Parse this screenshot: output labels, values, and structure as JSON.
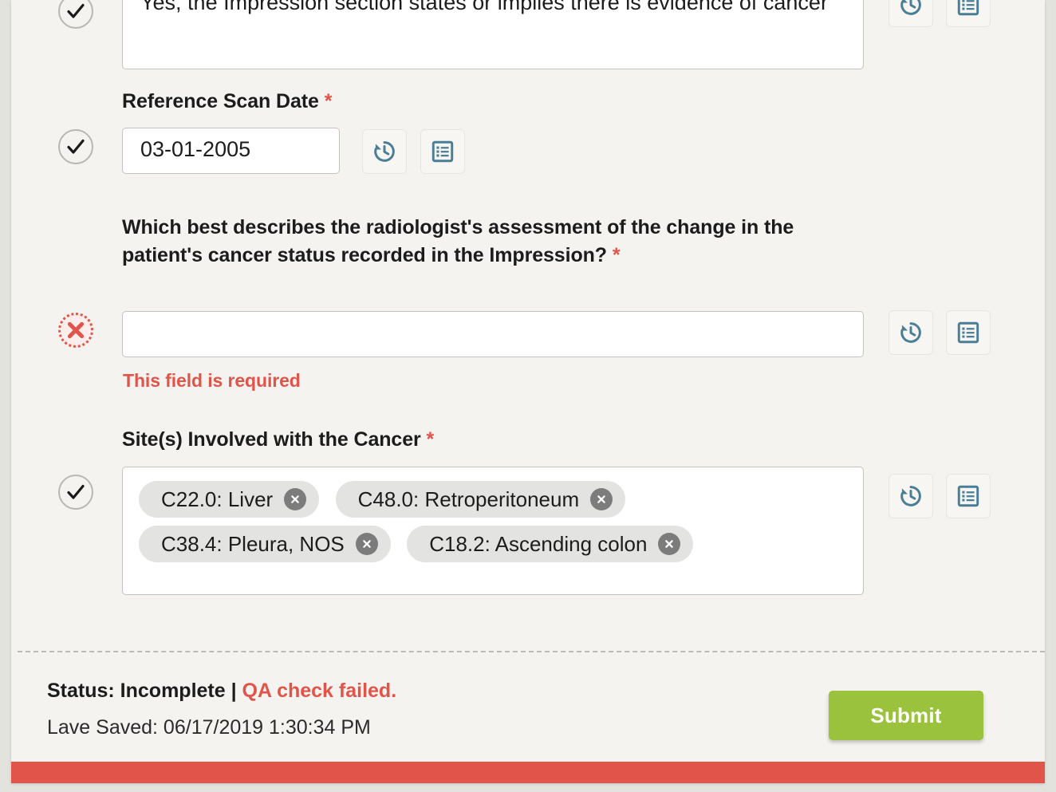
{
  "page": {
    "background_color": "#f4f3ef",
    "accent_error_color": "#e0544a",
    "accent_submit_color": "#9ac23c",
    "icon_color": "#4a7e96"
  },
  "fields": [
    {
      "name": "impression-evidence",
      "status": "ok",
      "label": "",
      "required": false,
      "value": "Yes, the Impression section states or implies there is evidence of cancer",
      "error": "",
      "history_icon": "history-icon",
      "notes_icon": "list-notes-icon"
    },
    {
      "name": "reference-scan-date",
      "status": "ok",
      "label": "Reference Scan Date",
      "required": true,
      "value": "03-01-2005",
      "error": "",
      "history_icon": "history-icon",
      "notes_icon": "list-notes-icon"
    },
    {
      "name": "cancer-status-change",
      "status": "error",
      "label": "Which best describes the radiologist's assessment of the change in the patient's cancer status recorded in the Impression?",
      "required": true,
      "value": "",
      "error": "This field is required",
      "history_icon": "history-icon",
      "notes_icon": "list-notes-icon"
    },
    {
      "name": "sites-involved",
      "status": "ok",
      "label": "Site(s) Involved with the Cancer",
      "required": true,
      "error": "",
      "history_icon": "history-icon",
      "notes_icon": "list-notes-icon",
      "chips": [
        "C22.0: Liver",
        "C48.0: Retroperitoneum",
        "C38.4: Pleura, NOS",
        "C18.2: Ascending colon"
      ]
    }
  ],
  "required_marker": "*",
  "footer": {
    "status_prefix": "Status: Incomplete",
    "separator": " | ",
    "qa_message": "QA check failed.",
    "last_saved": "Lave Saved: 06/17/2019 1:30:34 PM",
    "submit_label": "Submit"
  }
}
